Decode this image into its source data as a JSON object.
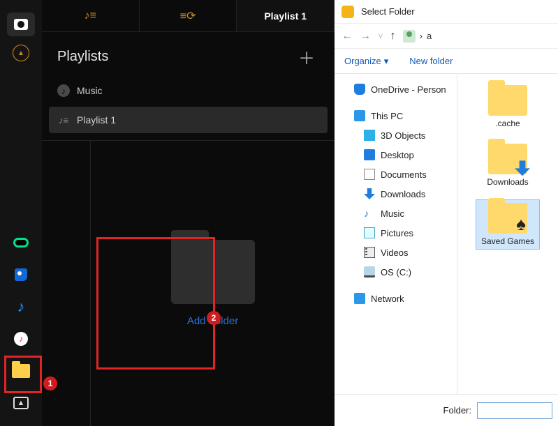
{
  "tabs": {
    "playlist_label": "Playlist 1"
  },
  "playlists": {
    "header": "Playlists",
    "items": [
      {
        "label": "Music"
      },
      {
        "label": "Playlist 1"
      }
    ]
  },
  "add_folder": {
    "label": "Add Folder"
  },
  "annotations": {
    "badge1": "1",
    "badge2": "2"
  },
  "dialog": {
    "title": "Select Folder",
    "breadcrumb_sep": "›",
    "breadcrumb_text": "a",
    "toolbar": {
      "organize": "Organize",
      "new_folder": "New folder"
    },
    "tree": [
      {
        "label": "OneDrive - Person",
        "icon": "cloud",
        "indent": 1
      },
      {
        "label": "This PC",
        "icon": "pc",
        "indent": 1
      },
      {
        "label": "3D Objects",
        "icon": "cube",
        "indent": 2
      },
      {
        "label": "Desktop",
        "icon": "desk",
        "indent": 2
      },
      {
        "label": "Documents",
        "icon": "doc",
        "indent": 2
      },
      {
        "label": "Downloads",
        "icon": "dl",
        "indent": 2
      },
      {
        "label": "Music",
        "icon": "mus",
        "indent": 2
      },
      {
        "label": "Pictures",
        "icon": "pic",
        "indent": 2
      },
      {
        "label": "Videos",
        "icon": "vid",
        "indent": 2
      },
      {
        "label": "OS (C:)",
        "icon": "drv",
        "indent": 2
      },
      {
        "label": "Network",
        "icon": "net",
        "indent": 1
      }
    ],
    "files": [
      {
        "label": ".cache",
        "variant": ""
      },
      {
        "label": "Downloads",
        "variant": "dl"
      },
      {
        "label": "Saved Games",
        "variant": "sg",
        "selected": true
      }
    ],
    "footer": {
      "label": "Folder:",
      "value": ""
    }
  }
}
